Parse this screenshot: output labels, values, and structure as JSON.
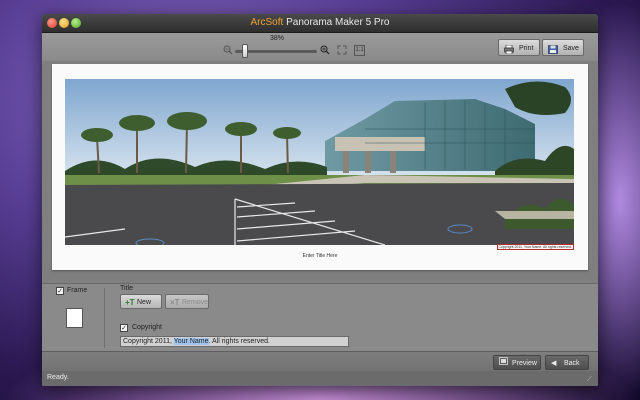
{
  "window": {
    "title_brand": "ArcSoft",
    "title_rest": " Panorama Maker 5 Pro"
  },
  "toolbar": {
    "zoom_percent": "38%",
    "zoom_value": 0.38,
    "print_label": "Print",
    "save_label": "Save",
    "icons": [
      "zoom-out-icon",
      "zoom-in-icon",
      "fit-to-window-icon",
      "actual-size-icon",
      "printer-icon",
      "floppy-disk-icon"
    ]
  },
  "preview": {
    "page_title": "Enter Title Here",
    "photo_copyright": "Copyright 2011, Your Name. All rights reserved."
  },
  "panel": {
    "frame_label": "Frame",
    "frame_checked": true,
    "title_heading": "Title",
    "new_label": "New",
    "remove_label": "Remove",
    "copyright_label": "Copyright",
    "copyright_checked": true,
    "copyright_before": "Copyright 2011, ",
    "copyright_highlight": "Your Name",
    "copyright_after": ". All rights reserved."
  },
  "footer": {
    "preview_label": "Preview",
    "back_label": "Back"
  },
  "status": {
    "text": "Ready."
  },
  "colors": {
    "brand_orange": "#f0a030",
    "selection_blue": "#9ec4f0",
    "panel_gray": "#8a8a8a",
    "dark_bar": "#6b6b6b"
  }
}
